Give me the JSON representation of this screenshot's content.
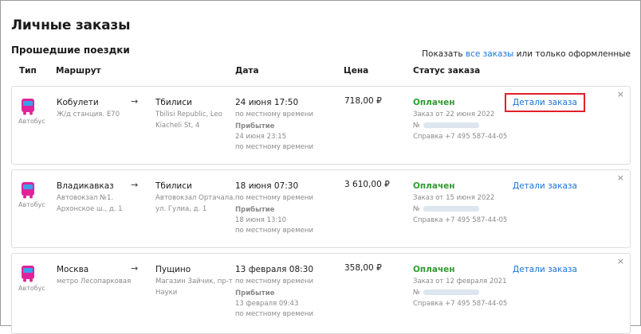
{
  "page": {
    "title": "Личные заказы",
    "section_title": "Прошедшие поездки"
  },
  "filter": {
    "prefix": "Показать ",
    "link": "все заказы",
    "suffix": " или только оформленные"
  },
  "columns": {
    "type": "Тип",
    "route": "Маршрут",
    "date": "Дата",
    "price": "Цена",
    "status": "Статус заказа"
  },
  "orders": [
    {
      "type": "Автобус",
      "from_city": "Кобулети",
      "from_detail": [
        "Ж/д станция. Е70"
      ],
      "arrow": "→",
      "to_city": "Тбилиси",
      "to_detail": [
        "Tbilisi Republic, Leo",
        "Kiacheli St, 4"
      ],
      "departure": "24 июня 17:50",
      "departure_note": "по местному времени",
      "arrival_label": "Прибытие",
      "arrival": "24 июня 23:15",
      "arrival_note": "по местному времени",
      "price": "718,00 ₽",
      "status": "Оплачен",
      "order_date": "Заказ от 22 июня 2022",
      "order_no_label": "№",
      "support": "Справка +7 495 587-44-05",
      "details_label": "Детали заказа"
    },
    {
      "type": "Автобус",
      "from_city": "Владикавказ",
      "from_detail": [
        "Автовокзал №1.",
        "Архонское ш., д. 1"
      ],
      "arrow": "→",
      "to_city": "Тбилиси",
      "to_detail": [
        "Автовокзал Ортачала.",
        "ул. Гулиа, д. 1"
      ],
      "departure": "18 июня 07:30",
      "departure_note": "по местному времени",
      "arrival_label": "Прибытие",
      "arrival": "18 июня 13:10",
      "arrival_note": "по местному времени",
      "price": "3 610,00 ₽",
      "status": "Оплачен",
      "order_date": "Заказ от 15 июня 2022",
      "order_no_label": "№",
      "support": "Справка +7 495 587-44-05",
      "details_label": "Детали заказа"
    },
    {
      "type": "Автобус",
      "from_city": "Москва",
      "from_detail": [
        "метро Лесопарковая"
      ],
      "arrow": "→",
      "to_city": "Пущино",
      "to_detail": [
        "Магазин Зайчик, пр-т",
        "Науки"
      ],
      "departure": "13 февраля 08:30",
      "departure_note": "по местному времени",
      "arrival_label": "Прибытие",
      "arrival": "13 февраля 09:43",
      "arrival_note": "по местному времени",
      "price": "358,00 ₽",
      "status": "Оплачен",
      "order_date": "Заказ от 12 февраля 2021",
      "order_no_label": "№",
      "support": "Справка +7 495 587-44-05",
      "details_label": "Детали заказа"
    }
  ],
  "close_glyph": "×",
  "colors": {
    "link": "#1a73d9",
    "status_paid": "#2e9b2e",
    "highlight": "#e0202a",
    "bus_icon": "#e0239a",
    "bus_window": "#3aa0ea"
  },
  "icons": {
    "bus": "bus-icon",
    "close": "close-icon"
  }
}
